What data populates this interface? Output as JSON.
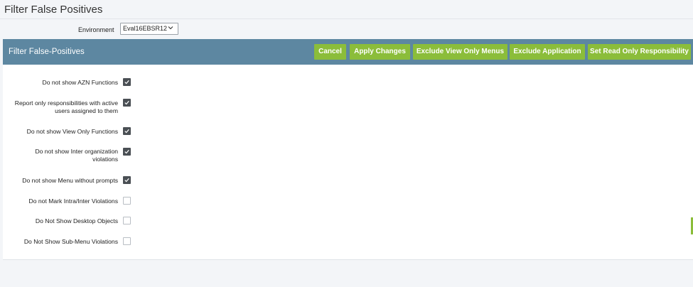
{
  "page": {
    "title": "Filter False Positives"
  },
  "environment": {
    "label": "Environment",
    "value": "Eval16EBSR12"
  },
  "panel": {
    "title": "Filter False-Positives",
    "buttons": {
      "cancel": "Cancel",
      "apply": "Apply Changes",
      "exclude_view_only": "Exclude View Only Menus",
      "exclude_application": "Exclude Application",
      "set_read_only": "Set Read Only Responsibility"
    }
  },
  "options": [
    {
      "label_lines": [
        "Do not show AZN Functions"
      ],
      "checked": true
    },
    {
      "label_lines": [
        "Report only responsibilities with active",
        "users assigned to them"
      ],
      "checked": true
    },
    {
      "label_lines": [
        "Do not show View Only Functions"
      ],
      "checked": true
    },
    {
      "label_lines": [
        "Do not show Inter organization",
        "violations"
      ],
      "checked": true
    },
    {
      "label_lines": [
        "Do not show Menu without prompts"
      ],
      "checked": true
    },
    {
      "label_lines": [
        "Do not Mark Intra/Inter Violations"
      ],
      "checked": false
    },
    {
      "label_lines": [
        "Do Not Show Desktop Objects"
      ],
      "checked": false
    },
    {
      "label_lines": [
        "Do Not Show Sub-Menu Violations"
      ],
      "checked": false
    }
  ],
  "colors": {
    "header": "#5d87a1",
    "button": "#8bbd3a",
    "checkbox_checked": "#4a4f54"
  }
}
